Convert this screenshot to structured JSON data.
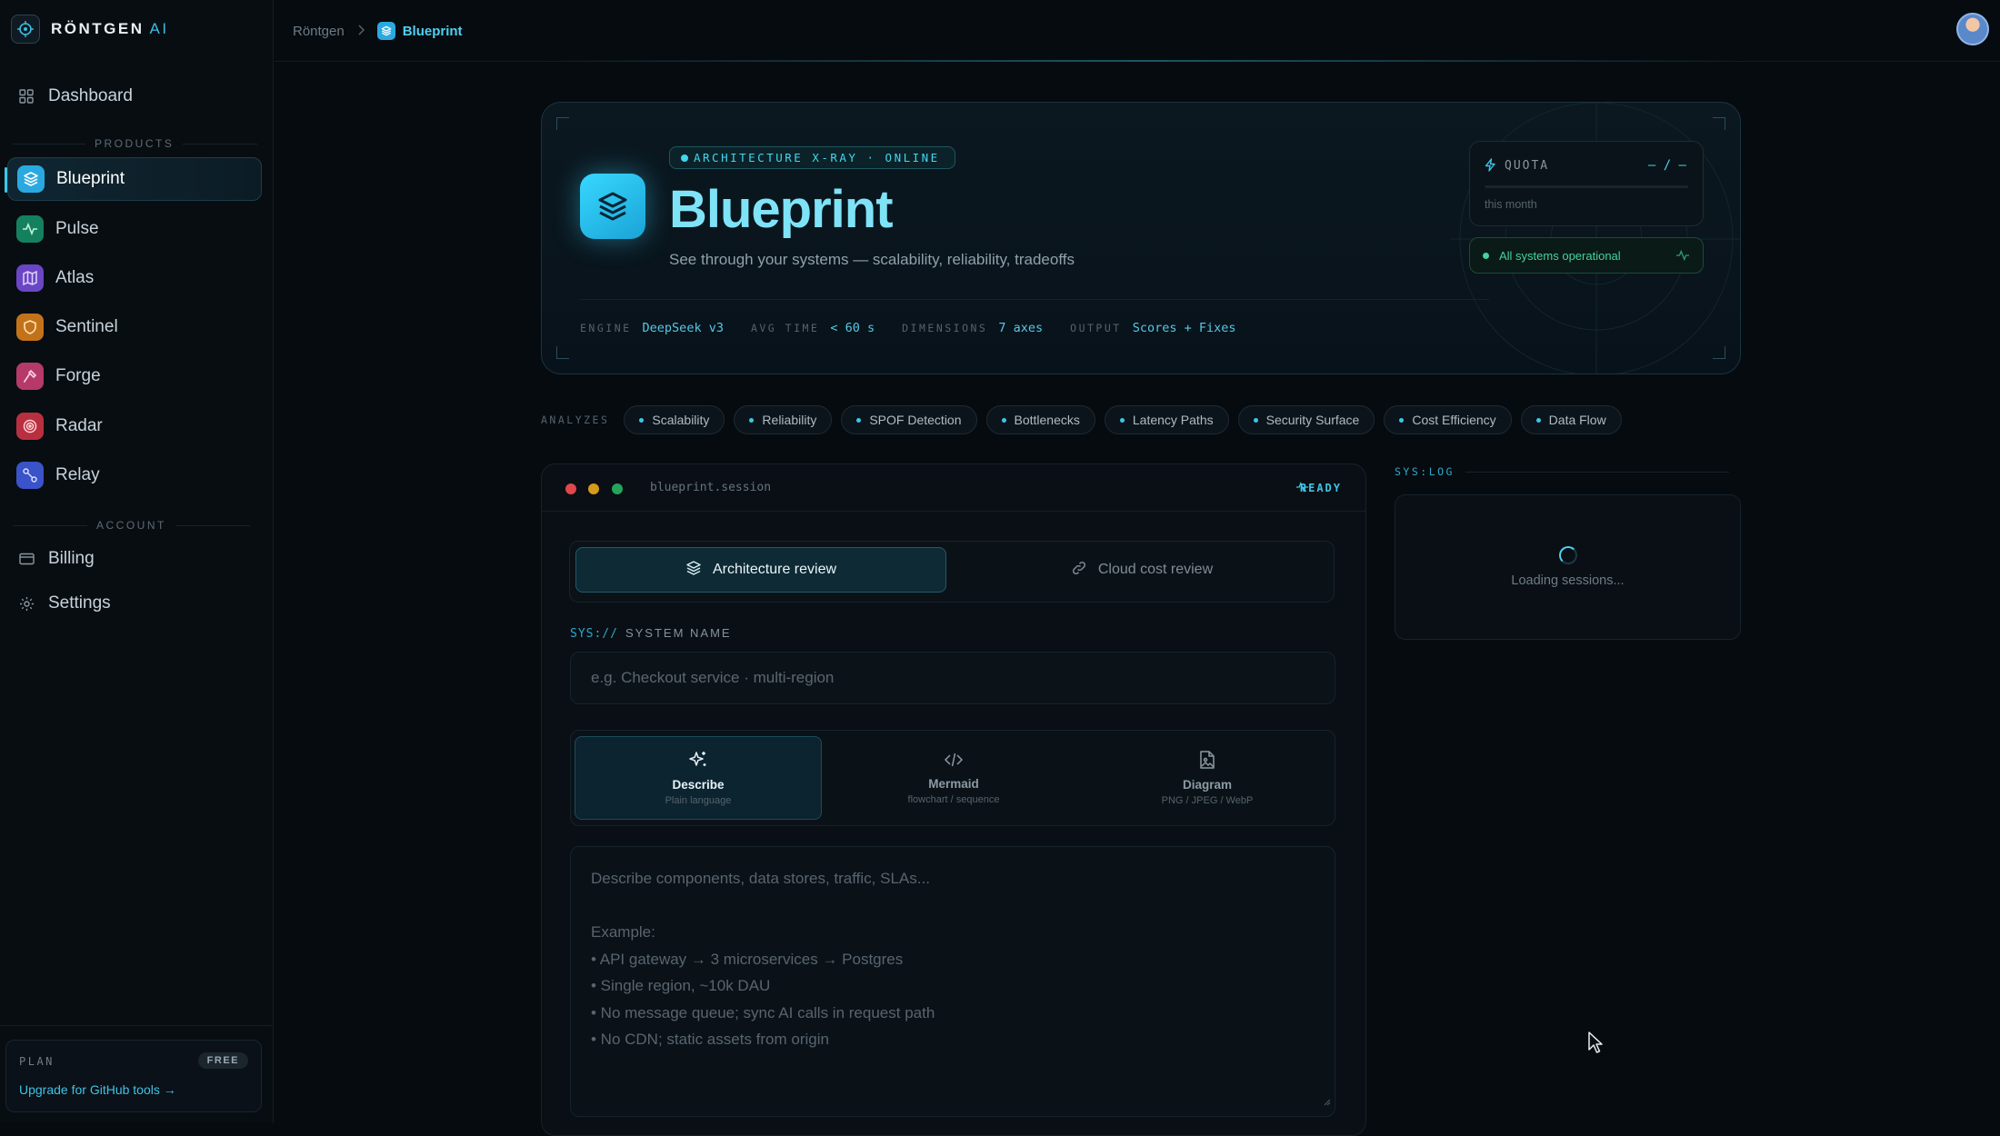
{
  "brand": {
    "name": "RÖNTGEN",
    "suffix": "AI"
  },
  "sidebar": {
    "dashboard": "Dashboard",
    "products_label": "PRODUCTS",
    "products": [
      {
        "label": "Blueprint",
        "color": "#2aa9e0",
        "icon": "layers-icon",
        "active": true
      },
      {
        "label": "Pulse",
        "color": "#1aa774",
        "icon": "pulse-icon"
      },
      {
        "label": "Atlas",
        "color": "#7d52d6",
        "icon": "map-icon"
      },
      {
        "label": "Sentinel",
        "color": "#e08a1c",
        "icon": "shield-icon"
      },
      {
        "label": "Forge",
        "color": "#d8457e",
        "icon": "hammer-icon"
      },
      {
        "label": "Radar",
        "color": "#d8384a",
        "icon": "radar-icon"
      },
      {
        "label": "Relay",
        "color": "#4a64e0",
        "icon": "relay-icon"
      }
    ],
    "account_label": "ACCOUNT",
    "billing": "Billing",
    "settings": "Settings",
    "plan": {
      "label": "PLAN",
      "badge": "FREE",
      "upgrade": "Upgrade for GitHub tools →"
    }
  },
  "topbar": {
    "crumb_root": "Röntgen",
    "crumb_current": "Blueprint"
  },
  "hero": {
    "badge": "ARCHITECTURE X-RAY · ONLINE",
    "title": "Blueprint",
    "subtitle": "See through your systems — scalability, reliability, tradeoffs",
    "stats": [
      {
        "k": "ENGINE",
        "v": "DeepSeek v3"
      },
      {
        "k": "AVG TIME",
        "v": "< 60 s"
      },
      {
        "k": "DIMENSIONS",
        "v": "7 axes"
      },
      {
        "k": "OUTPUT",
        "v": "Scores + Fixes"
      }
    ],
    "quota": {
      "label": "QUOTA",
      "value": "– / –",
      "period": "this month"
    },
    "status": "All systems operational"
  },
  "analyzes": {
    "label": "ANALYZES",
    "chips": [
      "Scalability",
      "Reliability",
      "SPOF Detection",
      "Bottlenecks",
      "Latency Paths",
      "Security Surface",
      "Cost Efficiency",
      "Data Flow"
    ]
  },
  "session": {
    "title": "blueprint.session",
    "status": "READY",
    "tabs": [
      "Architecture review",
      "Cloud cost review"
    ],
    "field_prefix": "SYS://",
    "field_label": "SYSTEM NAME",
    "field_placeholder": "e.g. Checkout service · multi-region",
    "modes": [
      {
        "title": "Describe",
        "sub": "Plain language"
      },
      {
        "title": "Mermaid",
        "sub": "flowchart / sequence"
      },
      {
        "title": "Diagram",
        "sub": "PNG / JPEG / WebP"
      }
    ],
    "textarea": {
      "l1": "Describe components, data stores, traffic, SLAs...",
      "l2": "Example:",
      "l3": "• API gateway → 3 microservices → Postgres",
      "l4": "• Single region, ~10k DAU",
      "l5": "• No message queue; sync AI calls in request path",
      "l6": "• No CDN; static assets from origin"
    }
  },
  "syslog": {
    "label": "SYS:LOG",
    "loading": "Loading sessions..."
  }
}
